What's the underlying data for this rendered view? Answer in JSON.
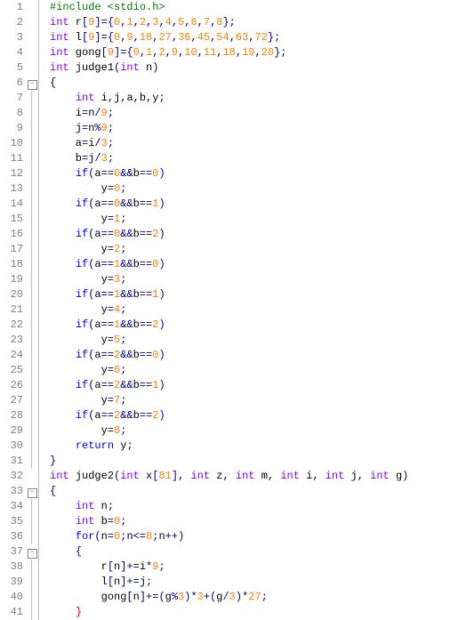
{
  "first_line": 1,
  "fold": {
    "5": "box",
    "6": "line",
    "7": "line",
    "8": "line",
    "9": "line",
    "10": "line",
    "11": "line",
    "12": "line",
    "13": "line",
    "14": "line",
    "15": "line",
    "16": "line",
    "17": "line",
    "18": "line",
    "19": "line",
    "20": "line",
    "21": "line",
    "22": "line",
    "23": "line",
    "24": "line",
    "25": "line",
    "26": "line",
    "27": "line",
    "28": "line",
    "29": "line",
    "30": "line",
    "32": "box",
    "33": "line",
    "34": "line",
    "35": "line",
    "36": "box",
    "37": "line",
    "38": "line",
    "39": "line",
    "40": "line"
  },
  "lines": [
    [
      [
        "dir",
        "#include <stdio.h>"
      ]
    ],
    [
      [
        "tp",
        "int"
      ],
      [
        "id",
        " r"
      ],
      [
        "pn",
        "["
      ],
      [
        "num",
        "9"
      ],
      [
        "pn",
        "]"
      ],
      [
        "op",
        "="
      ],
      [
        "pn",
        "{"
      ],
      [
        "num",
        "0"
      ],
      [
        "pn",
        ","
      ],
      [
        "num",
        "1"
      ],
      [
        "pn",
        ","
      ],
      [
        "num",
        "2"
      ],
      [
        "pn",
        ","
      ],
      [
        "num",
        "3"
      ],
      [
        "pn",
        ","
      ],
      [
        "num",
        "4"
      ],
      [
        "pn",
        ","
      ],
      [
        "num",
        "5"
      ],
      [
        "pn",
        ","
      ],
      [
        "num",
        "6"
      ],
      [
        "pn",
        ","
      ],
      [
        "num",
        "7"
      ],
      [
        "pn",
        ","
      ],
      [
        "num",
        "8"
      ],
      [
        "pn",
        "};"
      ]
    ],
    [
      [
        "tp",
        "int"
      ],
      [
        "id",
        " l"
      ],
      [
        "pn",
        "["
      ],
      [
        "num",
        "9"
      ],
      [
        "pn",
        "]"
      ],
      [
        "op",
        "="
      ],
      [
        "pn",
        "{"
      ],
      [
        "num",
        "0"
      ],
      [
        "pn",
        ","
      ],
      [
        "num",
        "9"
      ],
      [
        "pn",
        ","
      ],
      [
        "num",
        "18"
      ],
      [
        "pn",
        ","
      ],
      [
        "num",
        "27"
      ],
      [
        "pn",
        ","
      ],
      [
        "num",
        "36"
      ],
      [
        "pn",
        ","
      ],
      [
        "num",
        "45"
      ],
      [
        "pn",
        ","
      ],
      [
        "num",
        "54"
      ],
      [
        "pn",
        ","
      ],
      [
        "num",
        "63"
      ],
      [
        "pn",
        ","
      ],
      [
        "num",
        "72"
      ],
      [
        "pn",
        "};"
      ]
    ],
    [
      [
        "tp",
        "int"
      ],
      [
        "id",
        " gong"
      ],
      [
        "pn",
        "["
      ],
      [
        "num",
        "9"
      ],
      [
        "pn",
        "]"
      ],
      [
        "op",
        "="
      ],
      [
        "pn",
        "{"
      ],
      [
        "num",
        "0"
      ],
      [
        "pn",
        ","
      ],
      [
        "num",
        "1"
      ],
      [
        "pn",
        ","
      ],
      [
        "num",
        "2"
      ],
      [
        "pn",
        ","
      ],
      [
        "num",
        "9"
      ],
      [
        "pn",
        ","
      ],
      [
        "num",
        "10"
      ],
      [
        "pn",
        ","
      ],
      [
        "num",
        "11"
      ],
      [
        "pn",
        ","
      ],
      [
        "num",
        "18"
      ],
      [
        "pn",
        ","
      ],
      [
        "num",
        "19"
      ],
      [
        "pn",
        ","
      ],
      [
        "num",
        "20"
      ],
      [
        "pn",
        "};"
      ]
    ],
    [
      [
        "tp",
        "int"
      ],
      [
        "fn",
        " judge1"
      ],
      [
        "pn",
        "("
      ],
      [
        "tp",
        "int"
      ],
      [
        "id",
        " n"
      ],
      [
        "pn",
        ")"
      ]
    ],
    [
      [
        "pn",
        "{"
      ]
    ],
    [
      [
        "id",
        "    "
      ],
      [
        "tp",
        "int"
      ],
      [
        "id",
        " i"
      ],
      [
        "pn",
        ","
      ],
      [
        "id",
        "j"
      ],
      [
        "pn",
        ","
      ],
      [
        "id",
        "a"
      ],
      [
        "pn",
        ","
      ],
      [
        "id",
        "b"
      ],
      [
        "pn",
        ","
      ],
      [
        "id",
        "y"
      ],
      [
        "pn",
        ";"
      ]
    ],
    [
      [
        "id",
        "    i"
      ],
      [
        "op",
        "="
      ],
      [
        "id",
        "n"
      ],
      [
        "op",
        "/"
      ],
      [
        "num",
        "9"
      ],
      [
        "pn",
        ";"
      ]
    ],
    [
      [
        "id",
        "    j"
      ],
      [
        "op",
        "="
      ],
      [
        "id",
        "n"
      ],
      [
        "op",
        "%"
      ],
      [
        "num",
        "9"
      ],
      [
        "pn",
        ";"
      ]
    ],
    [
      [
        "id",
        "    a"
      ],
      [
        "op",
        "="
      ],
      [
        "id",
        "i"
      ],
      [
        "op",
        "/"
      ],
      [
        "num",
        "3"
      ],
      [
        "pn",
        ";"
      ]
    ],
    [
      [
        "id",
        "    b"
      ],
      [
        "op",
        "="
      ],
      [
        "id",
        "j"
      ],
      [
        "op",
        "/"
      ],
      [
        "num",
        "3"
      ],
      [
        "pn",
        ";"
      ]
    ],
    [
      [
        "id",
        "    "
      ],
      [
        "kw",
        "if"
      ],
      [
        "pn",
        "("
      ],
      [
        "id",
        "a"
      ],
      [
        "op",
        "=="
      ],
      [
        "num",
        "0"
      ],
      [
        "op",
        "&&"
      ],
      [
        "id",
        "b"
      ],
      [
        "op",
        "=="
      ],
      [
        "num",
        "0"
      ],
      [
        "pn",
        ")"
      ]
    ],
    [
      [
        "id",
        "        y"
      ],
      [
        "op",
        "="
      ],
      [
        "num",
        "0"
      ],
      [
        "pn",
        ";"
      ]
    ],
    [
      [
        "id",
        "    "
      ],
      [
        "kw",
        "if"
      ],
      [
        "pn",
        "("
      ],
      [
        "id",
        "a"
      ],
      [
        "op",
        "=="
      ],
      [
        "num",
        "0"
      ],
      [
        "op",
        "&&"
      ],
      [
        "id",
        "b"
      ],
      [
        "op",
        "=="
      ],
      [
        "num",
        "1"
      ],
      [
        "pn",
        ")"
      ]
    ],
    [
      [
        "id",
        "        y"
      ],
      [
        "op",
        "="
      ],
      [
        "num",
        "1"
      ],
      [
        "pn",
        ";"
      ]
    ],
    [
      [
        "id",
        "    "
      ],
      [
        "kw",
        "if"
      ],
      [
        "pn",
        "("
      ],
      [
        "id",
        "a"
      ],
      [
        "op",
        "=="
      ],
      [
        "num",
        "0"
      ],
      [
        "op",
        "&&"
      ],
      [
        "id",
        "b"
      ],
      [
        "op",
        "=="
      ],
      [
        "num",
        "2"
      ],
      [
        "pn",
        ")"
      ]
    ],
    [
      [
        "id",
        "        y"
      ],
      [
        "op",
        "="
      ],
      [
        "num",
        "2"
      ],
      [
        "pn",
        ";"
      ]
    ],
    [
      [
        "id",
        "    "
      ],
      [
        "kw",
        "if"
      ],
      [
        "pn",
        "("
      ],
      [
        "id",
        "a"
      ],
      [
        "op",
        "=="
      ],
      [
        "num",
        "1"
      ],
      [
        "op",
        "&&"
      ],
      [
        "id",
        "b"
      ],
      [
        "op",
        "=="
      ],
      [
        "num",
        "0"
      ],
      [
        "pn",
        ")"
      ]
    ],
    [
      [
        "id",
        "        y"
      ],
      [
        "op",
        "="
      ],
      [
        "num",
        "3"
      ],
      [
        "pn",
        ";"
      ]
    ],
    [
      [
        "id",
        "    "
      ],
      [
        "kw",
        "if"
      ],
      [
        "pn",
        "("
      ],
      [
        "id",
        "a"
      ],
      [
        "op",
        "=="
      ],
      [
        "num",
        "1"
      ],
      [
        "op",
        "&&"
      ],
      [
        "id",
        "b"
      ],
      [
        "op",
        "=="
      ],
      [
        "num",
        "1"
      ],
      [
        "pn",
        ")"
      ]
    ],
    [
      [
        "id",
        "        y"
      ],
      [
        "op",
        "="
      ],
      [
        "num",
        "4"
      ],
      [
        "pn",
        ";"
      ]
    ],
    [
      [
        "id",
        "    "
      ],
      [
        "kw",
        "if"
      ],
      [
        "pn",
        "("
      ],
      [
        "id",
        "a"
      ],
      [
        "op",
        "=="
      ],
      [
        "num",
        "1"
      ],
      [
        "op",
        "&&"
      ],
      [
        "id",
        "b"
      ],
      [
        "op",
        "=="
      ],
      [
        "num",
        "2"
      ],
      [
        "pn",
        ")"
      ]
    ],
    [
      [
        "id",
        "        y"
      ],
      [
        "op",
        "="
      ],
      [
        "num",
        "5"
      ],
      [
        "pn",
        ";"
      ]
    ],
    [
      [
        "id",
        "    "
      ],
      [
        "kw",
        "if"
      ],
      [
        "pn",
        "("
      ],
      [
        "id",
        "a"
      ],
      [
        "op",
        "=="
      ],
      [
        "num",
        "2"
      ],
      [
        "op",
        "&&"
      ],
      [
        "id",
        "b"
      ],
      [
        "op",
        "=="
      ],
      [
        "num",
        "0"
      ],
      [
        "pn",
        ")"
      ]
    ],
    [
      [
        "id",
        "        y"
      ],
      [
        "op",
        "="
      ],
      [
        "num",
        "6"
      ],
      [
        "pn",
        ";"
      ]
    ],
    [
      [
        "id",
        "    "
      ],
      [
        "kw",
        "if"
      ],
      [
        "pn",
        "("
      ],
      [
        "id",
        "a"
      ],
      [
        "op",
        "=="
      ],
      [
        "num",
        "2"
      ],
      [
        "op",
        "&&"
      ],
      [
        "id",
        "b"
      ],
      [
        "op",
        "=="
      ],
      [
        "num",
        "1"
      ],
      [
        "pn",
        ")"
      ]
    ],
    [
      [
        "id",
        "        y"
      ],
      [
        "op",
        "="
      ],
      [
        "num",
        "7"
      ],
      [
        "pn",
        ";"
      ]
    ],
    [
      [
        "id",
        "    "
      ],
      [
        "kw",
        "if"
      ],
      [
        "pn",
        "("
      ],
      [
        "id",
        "a"
      ],
      [
        "op",
        "=="
      ],
      [
        "num",
        "2"
      ],
      [
        "op",
        "&&"
      ],
      [
        "id",
        "b"
      ],
      [
        "op",
        "=="
      ],
      [
        "num",
        "2"
      ],
      [
        "pn",
        ")"
      ]
    ],
    [
      [
        "id",
        "        y"
      ],
      [
        "op",
        "="
      ],
      [
        "num",
        "8"
      ],
      [
        "pn",
        ";"
      ]
    ],
    [
      [
        "id",
        "    "
      ],
      [
        "kw",
        "return"
      ],
      [
        "id",
        " y"
      ],
      [
        "pn",
        ";"
      ]
    ],
    [
      [
        "pn",
        "}"
      ]
    ],
    [
      [
        "tp",
        "int"
      ],
      [
        "fn",
        " judge2"
      ],
      [
        "pn",
        "("
      ],
      [
        "tp",
        "int"
      ],
      [
        "id",
        " x"
      ],
      [
        "pn",
        "["
      ],
      [
        "num",
        "81"
      ],
      [
        "pn",
        "],"
      ],
      [
        "id",
        " "
      ],
      [
        "tp",
        "int"
      ],
      [
        "id",
        " z"
      ],
      [
        "pn",
        ","
      ],
      [
        "id",
        " "
      ],
      [
        "tp",
        "int"
      ],
      [
        "id",
        " m"
      ],
      [
        "pn",
        ","
      ],
      [
        "id",
        " "
      ],
      [
        "tp",
        "int"
      ],
      [
        "id",
        " i"
      ],
      [
        "pn",
        ","
      ],
      [
        "id",
        " "
      ],
      [
        "tp",
        "int"
      ],
      [
        "id",
        " j"
      ],
      [
        "pn",
        ","
      ],
      [
        "id",
        " "
      ],
      [
        "tp",
        "int"
      ],
      [
        "id",
        " g"
      ],
      [
        "pn",
        ")"
      ]
    ],
    [
      [
        "pn",
        "{"
      ]
    ],
    [
      [
        "id",
        "    "
      ],
      [
        "tp",
        "int"
      ],
      [
        "id",
        " n"
      ],
      [
        "pn",
        ";"
      ]
    ],
    [
      [
        "id",
        "    "
      ],
      [
        "tp",
        "int"
      ],
      [
        "id",
        " b"
      ],
      [
        "op",
        "="
      ],
      [
        "num",
        "0"
      ],
      [
        "pn",
        ";"
      ]
    ],
    [
      [
        "id",
        "    "
      ],
      [
        "kw",
        "for"
      ],
      [
        "pn",
        "("
      ],
      [
        "id",
        "n"
      ],
      [
        "op",
        "="
      ],
      [
        "num",
        "0"
      ],
      [
        "pn",
        ";"
      ],
      [
        "id",
        "n"
      ],
      [
        "op",
        "<="
      ],
      [
        "num",
        "8"
      ],
      [
        "pn",
        ";"
      ],
      [
        "id",
        "n"
      ],
      [
        "op",
        "++"
      ],
      [
        "pn",
        ")"
      ]
    ],
    [
      [
        "id",
        "    "
      ],
      [
        "pn",
        "{"
      ]
    ],
    [
      [
        "id",
        "        r"
      ],
      [
        "pn",
        "["
      ],
      [
        "id",
        "n"
      ],
      [
        "pn",
        "]"
      ],
      [
        "op",
        "+="
      ],
      [
        "id",
        "i"
      ],
      [
        "op",
        "*"
      ],
      [
        "num",
        "9"
      ],
      [
        "pn",
        ";"
      ]
    ],
    [
      [
        "id",
        "        l"
      ],
      [
        "pn",
        "["
      ],
      [
        "id",
        "n"
      ],
      [
        "pn",
        "]"
      ],
      [
        "op",
        "+="
      ],
      [
        "id",
        "j"
      ],
      [
        "pn",
        ";"
      ]
    ],
    [
      [
        "id",
        "        gong"
      ],
      [
        "pn",
        "["
      ],
      [
        "id",
        "n"
      ],
      [
        "pn",
        "]"
      ],
      [
        "op",
        "+="
      ],
      [
        "pn",
        "("
      ],
      [
        "id",
        "g"
      ],
      [
        "op",
        "%"
      ],
      [
        "num",
        "3"
      ],
      [
        "pn",
        ")"
      ],
      [
        "op",
        "*"
      ],
      [
        "num",
        "3"
      ],
      [
        "op",
        "+"
      ],
      [
        "pn",
        "("
      ],
      [
        "id",
        "g"
      ],
      [
        "op",
        "/"
      ],
      [
        "num",
        "3"
      ],
      [
        "pn",
        ")"
      ],
      [
        "op",
        "*"
      ],
      [
        "num",
        "27"
      ],
      [
        "pn",
        ";"
      ]
    ],
    [
      [
        "id",
        "    "
      ],
      [
        "br",
        "}"
      ]
    ]
  ]
}
